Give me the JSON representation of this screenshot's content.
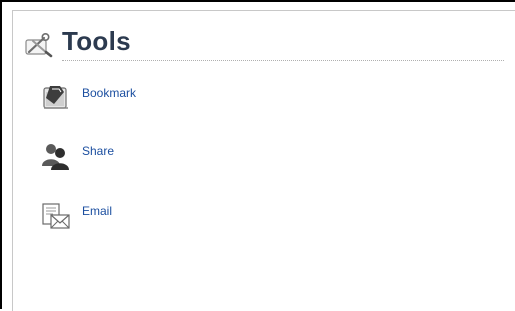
{
  "header": {
    "title": "Tools",
    "icon": "tools-icon"
  },
  "tools": {
    "items": [
      {
        "label": "Bookmark",
        "icon": "bookmark-icon"
      },
      {
        "label": "Share",
        "icon": "share-icon"
      },
      {
        "label": "Email",
        "icon": "email-icon"
      }
    ]
  },
  "colors": {
    "title": "#2c3a4f",
    "link": "#1c4fa0",
    "rule": "#b0b0b0"
  }
}
